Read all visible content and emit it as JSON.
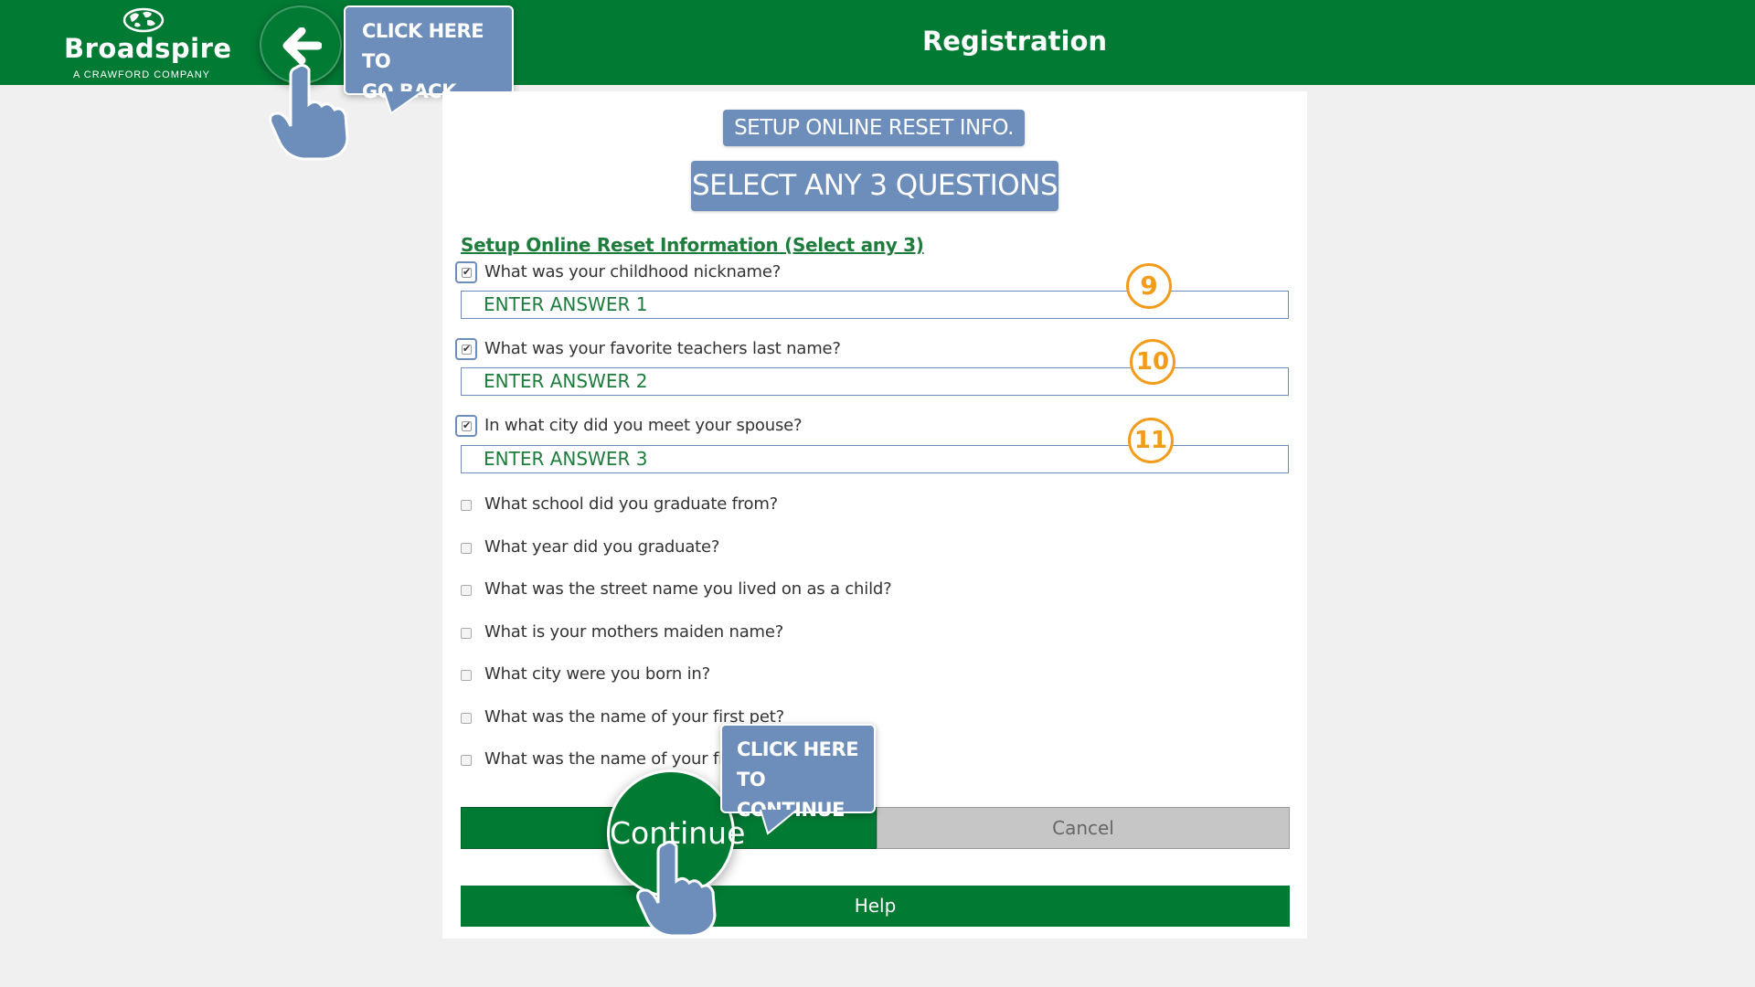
{
  "header": {
    "logo_name": "Broadspire",
    "logo_sub": "A CRAWFORD COMPANY",
    "title": "Registration",
    "back_icon": "arrow-left-icon"
  },
  "callouts": {
    "back": [
      "CLICK HERE TO",
      "GO BACK"
    ],
    "continue": [
      "CLICK HERE TO",
      "CONTINUE"
    ]
  },
  "main": {
    "tag_setup": "SETUP ONLINE RESET INFO.",
    "tag_select": "SELECT ANY 3 QUESTIONS",
    "section_link": "Setup Online Reset Information (Select any 3)",
    "questions": [
      {
        "label": "What was your childhood nickname?",
        "checked": true,
        "answer": "ENTER ANSWER 1",
        "step": "9"
      },
      {
        "label": "What was your favorite teachers last name?",
        "checked": true,
        "answer": "ENTER ANSWER 2",
        "step": "10"
      },
      {
        "label": "In what city did you meet your spouse?",
        "checked": true,
        "answer": "ENTER ANSWER 3",
        "step": "11"
      },
      {
        "label": "What school did you graduate from?",
        "checked": false
      },
      {
        "label": "What year did you graduate?",
        "checked": false
      },
      {
        "label": "What was the street name you lived on as a child?",
        "checked": false
      },
      {
        "label": "What is your mothers maiden name?",
        "checked": false
      },
      {
        "label": "What city were you born in?",
        "checked": false
      },
      {
        "label": "What was the name of your first pet?",
        "checked": false
      },
      {
        "label": "What was the name of your firs",
        "checked": false
      }
    ],
    "continue_label": "Continue",
    "cancel_label": "Cancel",
    "help_label": "Help"
  },
  "colors": {
    "brand_green": "#017a34",
    "callout_blue": "#6d8dba",
    "step_orange": "#f39b1a"
  }
}
